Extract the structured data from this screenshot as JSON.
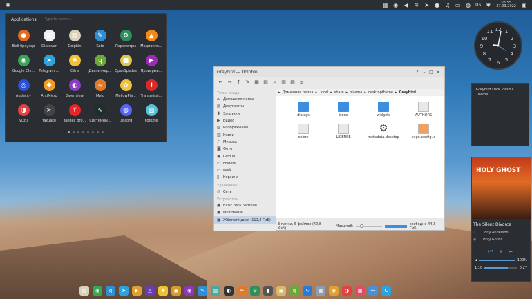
{
  "panel": {
    "clock_time": "08:55",
    "clock_date": "27.03.2022",
    "lang": "US"
  },
  "appmenu": {
    "title": "Applications",
    "search_placeholder": "Type to search...",
    "apps": [
      {
        "label": "Веб-браузер",
        "color": "#e66a1e",
        "icon": "firefox-icon",
        "glyph": "●"
      },
      {
        "label": "Discover",
        "color": "#eeeeee",
        "icon": "discover-icon",
        "glyph": "▣"
      },
      {
        "label": "Dolphin",
        "color": "#d9d1b8",
        "icon": "dolphin-icon",
        "glyph": "▤"
      },
      {
        "label": "Kate",
        "color": "#2f8fd6",
        "icon": "kate-icon",
        "glyph": "✎"
      },
      {
        "label": "Параметры",
        "color": "#2f8f5a",
        "icon": "settings-icon",
        "glyph": "⚙"
      },
      {
        "label": "Медиапле...",
        "color": "#f08a1a",
        "icon": "vlc-icon",
        "glyph": "▲"
      },
      {
        "label": "Google Chr...",
        "color": "#34a853",
        "icon": "chrome-icon",
        "glyph": "◉"
      },
      {
        "label": "Telegram ...",
        "color": "#2aa3e0",
        "icon": "telegram-icon",
        "glyph": "➤"
      },
      {
        "label": "Citra",
        "color": "#f3c033",
        "icon": "citra-icon",
        "glyph": "✺"
      },
      {
        "label": "Диспетчер...",
        "color": "#6aa837",
        "icon": "qbittorrent-icon",
        "glyph": "q"
      },
      {
        "label": "OpenSpades",
        "color": "#e4c545",
        "icon": "openspades-icon",
        "glyph": "■"
      },
      {
        "label": "Проигрыв...",
        "color": "#9a2db8",
        "icon": "player-icon",
        "glyph": "▶"
      },
      {
        "label": "Audacity",
        "color": "#2a4fd8",
        "icon": "audacity-icon",
        "glyph": "◎"
      },
      {
        "label": "AntiMicro",
        "color": "#f29b1e",
        "icon": "gamepad-icon",
        "glyph": "✚"
      },
      {
        "label": "Gwenview",
        "color": "#8e3cc8",
        "icon": "gwenview-icon",
        "glyph": "◐"
      },
      {
        "label": "Meld",
        "color": "#e07a2a",
        "icon": "meld-icon",
        "glyph": "≋"
      },
      {
        "label": "MellowPla...",
        "color": "#f0c23a",
        "icon": "mellowplayer-icon",
        "glyph": "✿"
      },
      {
        "label": "Transmissi...",
        "color": "#d92a2a",
        "icon": "transmission-icon",
        "glyph": "⬇"
      },
      {
        "label": "yuzu",
        "color": "#e34040",
        "icon": "yuzu-icon",
        "glyph": "◑"
      },
      {
        "label": "Yakuake",
        "color": "#444444",
        "icon": "terminal-icon",
        "glyph": ">"
      },
      {
        "label": "Yandex Bro...",
        "color": "#e3262a",
        "icon": "yandex-icon",
        "glyph": "Y"
      },
      {
        "label": "Системны...",
        "color": "#1e2f2a",
        "icon": "system-monitor-icon",
        "glyph": "∿"
      },
      {
        "label": "Discord",
        "color": "#5865f2",
        "icon": "discord-icon",
        "glyph": "◍"
      },
      {
        "label": "Fotoxte",
        "color": "#58c2d8",
        "icon": "photo-icon",
        "glyph": "▧"
      }
    ]
  },
  "dolphin": {
    "title": "Greybird — Dolphin",
    "sidebar_places": "Точки входа",
    "places": [
      {
        "label": "Домашняя папка",
        "icon": "home-icon",
        "glyph": "⌂"
      },
      {
        "label": "Документы",
        "icon": "documents-icon",
        "glyph": "▤"
      },
      {
        "label": "Загрузки",
        "icon": "downloads-icon",
        "glyph": "⬇"
      },
      {
        "label": "Видео",
        "icon": "video-icon",
        "glyph": "▶"
      },
      {
        "label": "Изображения",
        "icon": "pictures-icon",
        "glyph": "▨"
      },
      {
        "label": "Книги",
        "icon": "books-icon",
        "glyph": "▥"
      },
      {
        "label": "Музыка",
        "icon": "music-icon",
        "glyph": "♪"
      },
      {
        "label": "Фото",
        "icon": "photo-icon",
        "glyph": "◙"
      },
      {
        "label": "GitHub",
        "icon": "github-icon",
        "glyph": "◉"
      },
      {
        "label": "Folders",
        "icon": "folder-icon",
        "glyph": "▭"
      },
      {
        "label": "work",
        "icon": "folder-icon",
        "glyph": "▭"
      },
      {
        "label": "Корзина",
        "icon": "trash-icon",
        "glyph": "▯"
      }
    ],
    "sidebar_remote": "Удалённые",
    "remote": [
      {
        "label": "Сеть",
        "icon": "network-icon",
        "glyph": "◎"
      }
    ],
    "sidebar_devices": "Устройства",
    "devices": [
      {
        "label": "Basic data partition",
        "icon": "drive-icon",
        "glyph": "▣"
      },
      {
        "label": "Multimedia",
        "icon": "drive-icon",
        "glyph": "▣"
      },
      {
        "label": "Жёсткий диск (111,8 ГиБ)",
        "icon": "drive-icon",
        "glyph": "▣"
      }
    ],
    "breadcrumb": [
      "Домашняя папка",
      ".local",
      "share",
      "plasma",
      "desktoptheme"
    ],
    "breadcrumb_current": "Greybird",
    "files": [
      {
        "name": "dialogs",
        "kind": "folder"
      },
      {
        "name": "icons",
        "kind": "folder"
      },
      {
        "name": "widgets",
        "kind": "folder"
      },
      {
        "name": "AUTHORS",
        "kind": "doc"
      },
      {
        "name": "colors",
        "kind": "doc"
      },
      {
        "name": "LICENSE",
        "kind": "doc"
      },
      {
        "name": "metadata.desktop",
        "kind": "gear"
      },
      {
        "name": "svgo.config.js",
        "kind": "js"
      }
    ],
    "status_text": "3 папки, 5 файлов (40,8 КиБ)",
    "zoom_label": "Масштаб:",
    "free_text": "свободно 44,3 ГиБ"
  },
  "note": {
    "text": "Greybird Dark Plasma Theme"
  },
  "media": {
    "album_title": "HOLY GHOST",
    "song": "The Silent Divorce",
    "artist": "Tony Anderson",
    "album": "Holy Ghost",
    "volume": "100%",
    "elapsed": "1:10",
    "remaining": "0:27",
    "volume_level": 1.0,
    "progress": 0.72
  }
}
